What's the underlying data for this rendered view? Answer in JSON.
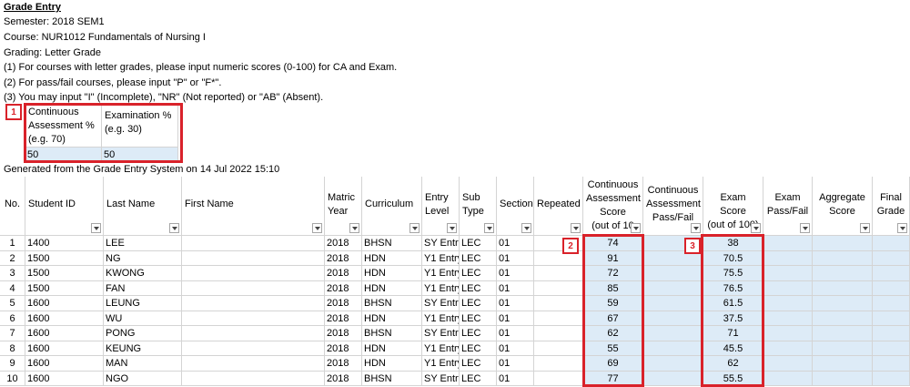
{
  "info": {
    "title": "Grade Entry",
    "semester": "Semester: 2018 SEM1",
    "course": "Course: NUR1012 Fundamentals of Nursing I",
    "grading": "Grading: Letter Grade",
    "note1": "(1) For courses with letter grades, please input numeric scores (0-100) for CA and Exam.",
    "note2": "(2) For pass/fail courses, please input \"P\" or \"F*\".",
    "note3": "(3) You may input \"I\" (Incomplete), \"NR\" (Not reported) or \"AB\" (Absent).",
    "generated": "Generated from the Grade Entry System on 14 Jul 2022 15:10"
  },
  "weights": {
    "ca_label_1": "Continuous",
    "ca_label_2": "Assessment %",
    "ca_label_3": "(e.g. 70)",
    "exam_label_1": "Examination %",
    "exam_label_2": "(e.g. 30)",
    "ca_value": "50",
    "exam_value": "50"
  },
  "badges": {
    "one": "1",
    "two": "2",
    "three": "3"
  },
  "headers": {
    "no": "No.",
    "student_id": "Student ID",
    "last_name": "Last Name",
    "first_name": "First Name",
    "matric_1": "Matric",
    "matric_2": "Year",
    "curriculum": "Curriculum",
    "entry_1": "Entry",
    "entry_2": "Level",
    "sub_1": "Sub",
    "sub_2": "Type",
    "section": "Section",
    "repeated": "Repeated",
    "ca_score_1": "Continuous",
    "ca_score_2": "Assessment",
    "ca_score_3": "Score",
    "ca_score_4": "(out of 10",
    "ca_pf_1": "Continuous",
    "ca_pf_2": "Assessment",
    "ca_pf_3": "Pass/Fail",
    "exam_score_1": "Exam Score",
    "exam_score_2": "(out of 100)",
    "exam_pf_1": "Exam",
    "exam_pf_2": "Pass/Fail",
    "aggregate_1": "Aggregate",
    "aggregate_2": "Score",
    "final_1": "Final",
    "final_2": "Grade"
  },
  "rows": [
    {
      "no": "1",
      "id": "1400",
      "last": "LEE",
      "year": "2018",
      "curr": "BHSN",
      "entry": "SY Entry",
      "sub": "LEC",
      "sec": "01",
      "ca": "74",
      "exam": "38"
    },
    {
      "no": "2",
      "id": "1500",
      "last": "NG",
      "year": "2018",
      "curr": "HDN",
      "entry": "Y1 Entry",
      "sub": "LEC",
      "sec": "01",
      "ca": "91",
      "exam": "70.5"
    },
    {
      "no": "3",
      "id": "1500",
      "last": "KWONG",
      "year": "2018",
      "curr": "HDN",
      "entry": "Y1 Entry",
      "sub": "LEC",
      "sec": "01",
      "ca": "72",
      "exam": "75.5"
    },
    {
      "no": "4",
      "id": "1500",
      "last": "FAN",
      "year": "2018",
      "curr": "HDN",
      "entry": "Y1 Entry",
      "sub": "LEC",
      "sec": "01",
      "ca": "85",
      "exam": "76.5"
    },
    {
      "no": "5",
      "id": "1600",
      "last": "LEUNG",
      "year": "2018",
      "curr": "BHSN",
      "entry": "SY Entry",
      "sub": "LEC",
      "sec": "01",
      "ca": "59",
      "exam": "61.5"
    },
    {
      "no": "6",
      "id": "1600",
      "last": "WU",
      "year": "2018",
      "curr": "HDN",
      "entry": "Y1 Entry",
      "sub": "LEC",
      "sec": "01",
      "ca": "67",
      "exam": "37.5"
    },
    {
      "no": "7",
      "id": "1600",
      "last": "PONG",
      "year": "2018",
      "curr": "BHSN",
      "entry": "SY Entry",
      "sub": "LEC",
      "sec": "01",
      "ca": "62",
      "exam": "71"
    },
    {
      "no": "8",
      "id": "1600",
      "last": "KEUNG",
      "year": "2018",
      "curr": "HDN",
      "entry": "Y1 Entry",
      "sub": "LEC",
      "sec": "01",
      "ca": "55",
      "exam": "45.5"
    },
    {
      "no": "9",
      "id": "1600",
      "last": "MAN",
      "year": "2018",
      "curr": "HDN",
      "entry": "Y1 Entry",
      "sub": "LEC",
      "sec": "01",
      "ca": "69",
      "exam": "62"
    },
    {
      "no": "10",
      "id": "1600",
      "last": "NGO",
      "year": "2018",
      "curr": "BHSN",
      "entry": "SY Entry",
      "sub": "LEC",
      "sec": "01",
      "ca": "77",
      "exam": "55.5"
    }
  ],
  "colors": {
    "annotation_red": "#d9222a",
    "input_blue": "#ddebf7",
    "gridline": "#d4d4d4"
  }
}
